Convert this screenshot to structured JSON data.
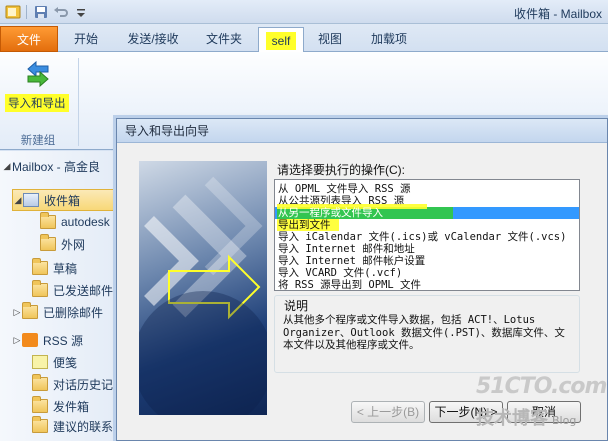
{
  "window": {
    "title": "收件箱 - Mailbox"
  },
  "quick_access": {
    "icons": [
      "outlook-app-icon",
      "save-icon",
      "undo-icon",
      "customize-qat-icon"
    ]
  },
  "ribbon": {
    "tabs": [
      {
        "label": "文件"
      },
      {
        "label": "开始"
      },
      {
        "label": "发送/接收"
      },
      {
        "label": "文件夹"
      },
      {
        "label": "self",
        "active": true
      },
      {
        "label": "视图"
      },
      {
        "label": "加载项"
      }
    ],
    "import_export_button": {
      "label": "导入和导出",
      "icon": "import-export-arrows-icon"
    },
    "group_label": "新建组"
  },
  "nav": {
    "items": [
      {
        "label": "Mailbox - 高金良",
        "icon": "none",
        "expander": "◢"
      },
      {
        "label": "收件箱",
        "icon": "inbox-icon",
        "expander": "◢",
        "selected": true
      },
      {
        "label": "autodesk",
        "icon": "folder-icon"
      },
      {
        "label": "外网",
        "icon": "folder-icon"
      },
      {
        "label": "草稿",
        "icon": "drafts-icon"
      },
      {
        "label": "已发送邮件",
        "icon": "sent-icon"
      },
      {
        "label": "已删除邮件",
        "icon": "deleted-icon",
        "expander": "▷"
      },
      {
        "label": "RSS 源",
        "icon": "rss-icon",
        "expander": "▷"
      },
      {
        "label": "便笺",
        "icon": "notes-icon"
      },
      {
        "label": "对话历史记录",
        "icon": "folder-icon"
      },
      {
        "label": "发件箱",
        "icon": "outbox-icon"
      },
      {
        "label": "建议的联系人",
        "icon": "contacts-icon"
      }
    ]
  },
  "dialog": {
    "title": "导入和导出向导",
    "prompt": "请选择要执行的操作(C):",
    "options": [
      "从 OPML 文件导入 RSS 源",
      "从公共源列表导入 RSS 源",
      "从另一程序或文件导入",
      "导出到文件",
      "导入 iCalendar 文件(.ics)或 vCalendar 文件(.vcs)",
      "导入 Internet 邮件和地址",
      "导入 Internet 邮件帐户设置",
      "导入 VCARD 文件(.vcf)",
      "将 RSS 源导出到 OPML 文件"
    ],
    "selected_index": 2,
    "description_label": "说明",
    "description": "从其他多个程序或文件导入数据，包括 ACT!、Lotus Organizer、Outlook 数据文件(.PST)、数据库文件、文本文件以及其他程序或文件。",
    "buttons": {
      "back": "< 上一步(B)",
      "next": "下一步(N) >",
      "cancel": "取消"
    }
  },
  "watermark": {
    "line1": "51CTO.com",
    "line2": "技术博客",
    "blog": "Blog"
  },
  "colors": {
    "highlight_yellow": "#ffff2a",
    "highlight_green": "#33cc33",
    "selection_blue": "#3399ff",
    "file_tab_orange": "#e36e0d"
  }
}
